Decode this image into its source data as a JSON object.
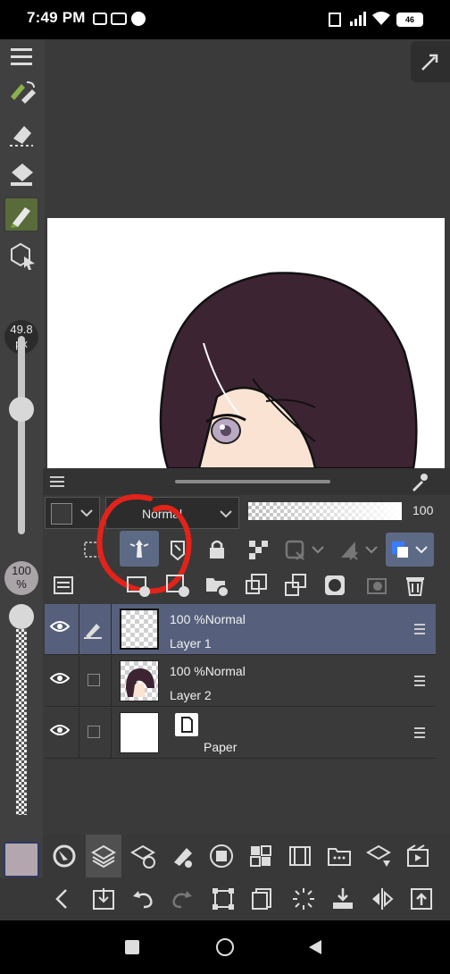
{
  "status_bar": {
    "time": "7:49 PM",
    "battery": "46"
  },
  "brush_size": {
    "value": "49.8",
    "unit": "px"
  },
  "brush_opacity": {
    "value": "100",
    "unit": "%"
  },
  "layer_panel": {
    "blend_mode": "Normal",
    "opacity_value": "100",
    "layers": [
      {
        "mode_text": "100 %Normal",
        "name": "Layer 1",
        "selected": true
      },
      {
        "mode_text": "100 %Normal",
        "name": "Layer 2",
        "selected": false
      },
      {
        "mode_text": "",
        "name": "Paper",
        "selected": false
      }
    ]
  },
  "colors": {
    "accent_selected_row": "#56607c",
    "active_tool": "#5a6b3a",
    "annotation": "#e2231a",
    "hair": "#3d2433",
    "skin": "#fbe3d3"
  },
  "icons": {
    "left_toolbar": [
      "menu-icon",
      "pen-swap-icon",
      "eraser-icon",
      "fill-bucket-icon",
      "marker-icon",
      "select-object-icon"
    ],
    "layer_toolbar": [
      "layer-property-icon",
      "reference-layer-icon",
      "draft-layer-icon",
      "lock-icon",
      "lock-transparent-icon",
      "clip-icon",
      "mask-icon",
      "color-icon"
    ],
    "layer_actions": [
      "layer-list-icon",
      "new-raster-layer-icon",
      "new-vector-layer-icon",
      "new-folder-icon",
      "copy-layer-icon",
      "merge-down-icon",
      "mask-create-icon",
      "apply-mask-icon",
      "delete-icon"
    ],
    "bottom_row1": [
      "navigator-icon",
      "layers-icon",
      "sub-tool-icon",
      "brush-size-icon",
      "gradient-icon",
      "material-icon",
      "timeline-icon",
      "command-bar-icon",
      "edit-icon",
      "animation-icon"
    ],
    "bottom_row2": [
      "back-icon",
      "import-icon",
      "undo-icon",
      "redo-icon",
      "transform-icon",
      "copy-icon",
      "loading-icon",
      "save-icon",
      "flip-icon",
      "export-icon"
    ]
  }
}
